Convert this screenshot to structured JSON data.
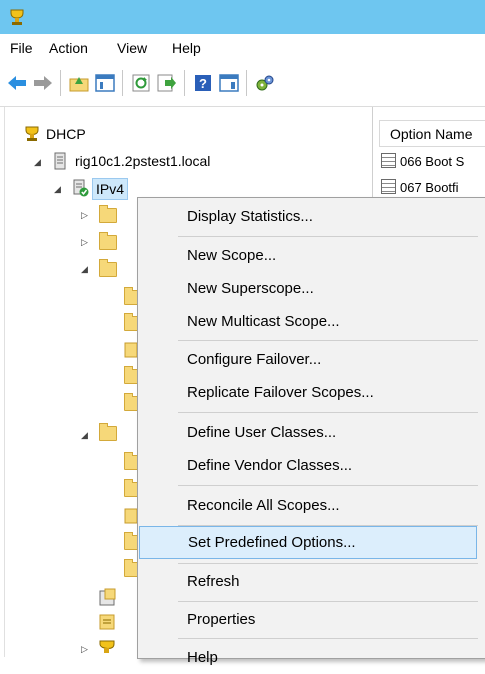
{
  "menubar": {
    "items": [
      "File",
      "Action",
      "View",
      "Help"
    ]
  },
  "tree": {
    "root": "DHCP",
    "server": "rig10c1.2pstest1.local",
    "ipv4": "IPv4"
  },
  "right_pane": {
    "column_header": "Option Name",
    "rows": [
      "066 Boot S",
      "067 Bootfi"
    ]
  },
  "context_menu": {
    "items": [
      "Display Statistics...",
      "New Scope...",
      "New Superscope...",
      "New Multicast Scope...",
      "Configure Failover...",
      "Replicate Failover Scopes...",
      "Define User Classes...",
      "Define Vendor Classes...",
      "Reconcile All Scopes...",
      "Set Predefined Options...",
      "Refresh",
      "Properties",
      "Help"
    ],
    "highlighted": "Set Predefined Options..."
  },
  "colors": {
    "titlebar": "#6ec6f0",
    "menu_highlight_fill": "#dceefc",
    "menu_highlight_border": "#7ab6e8"
  }
}
